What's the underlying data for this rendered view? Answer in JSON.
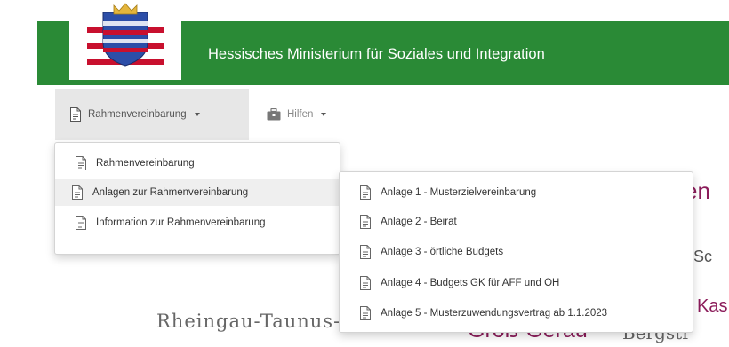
{
  "header": {
    "title": "Hessisches Ministerium für Soziales und Integration",
    "bar_color": "#2a8a36",
    "logo_icon": "hessen-coat-of-arms-icon"
  },
  "nav": {
    "items": [
      {
        "label": "Rahmenvereinbarung",
        "icon": "document-icon",
        "active": true,
        "has_dropdown": true
      },
      {
        "label": "Hilfen",
        "icon": "briefcase-icon",
        "active": false,
        "has_dropdown": true
      }
    ]
  },
  "dropdown": {
    "items": [
      {
        "label": "Rahmenvereinbarung",
        "icon": "document-icon"
      },
      {
        "label": "Anlagen zur Rahmenvereinbarung",
        "icon": "document-icon",
        "highlighted": true
      },
      {
        "label": "Information zur Rahmenvereinbarung",
        "icon": "document-icon"
      }
    ]
  },
  "submenu": {
    "items": [
      {
        "label": "Anlage 1 - Musterzielvereinbarung",
        "icon": "document-icon"
      },
      {
        "label": "Anlage 2 - Beirat",
        "icon": "document-icon"
      },
      {
        "label": "Anlage 3 - örtliche Budgets",
        "icon": "document-icon"
      },
      {
        "label": "Anlage 4 - Budgets GK für AFF und OH",
        "icon": "document-icon"
      },
      {
        "label": "Anlage 5 - Musterzuwendungsvertrag ab 1.1.2023",
        "icon": "document-icon"
      }
    ]
  },
  "background_text": {
    "fragment_en": "en",
    "fragment_sc": "Sc",
    "fragment_kas": "Kas",
    "rheingau": "Rheingau-Taunus-Kreis",
    "gross_gerau": "Groß-Gerau",
    "bergstr": "Bergstr"
  },
  "colors": {
    "accent_magenta": "#8b1c5a",
    "menu_highlight": "#efefef",
    "nav_active": "#e7e7e7"
  }
}
